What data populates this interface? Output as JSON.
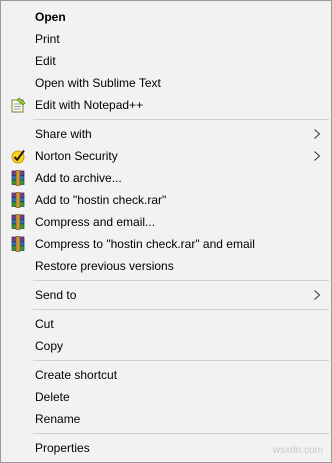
{
  "menu": {
    "open": "Open",
    "print": "Print",
    "edit": "Edit",
    "open_with_sublime": "Open with Sublime Text",
    "edit_with_notepad": "Edit with Notepad++",
    "share_with": "Share with",
    "norton": "Norton Security",
    "add_to_archive": "Add to archive...",
    "add_to_rar": "Add to \"hostin check.rar\"",
    "compress_email": "Compress and email...",
    "compress_rar_email": "Compress to \"hostin check.rar\" and email",
    "restore": "Restore previous versions",
    "send_to": "Send to",
    "cut": "Cut",
    "copy": "Copy",
    "create_shortcut": "Create shortcut",
    "delete": "Delete",
    "rename": "Rename",
    "properties": "Properties"
  },
  "icons": {
    "notepad": "notepad-plus-plus-icon",
    "norton": "norton-check-icon",
    "winrar": "winrar-books-icon",
    "submenu": "chevron-right-icon"
  },
  "watermark": "wsxdn.com"
}
